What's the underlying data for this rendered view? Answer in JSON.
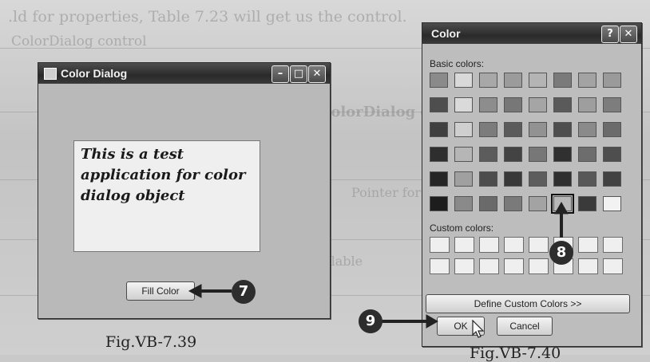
{
  "background_text": [
    ".ld for properties, Table 7.23 will get us the control.",
    "ColorDialog control",
    "ColorDialog co",
    "Fill Color",
    "Pointer for the",
    "Available",
    "Custom"
  ],
  "window_left": {
    "title": "Color Dialog",
    "minimize_glyph": "–",
    "maximize_glyph": "□",
    "close_glyph": "✕",
    "text_content": "This is a test application for color dialog object",
    "fill_button_label": "Fill Color"
  },
  "window_right": {
    "title": "Color",
    "help_glyph": "?",
    "close_glyph": "✕",
    "basic_colors_label": "Basic colors:",
    "custom_colors_label": "Custom colors:",
    "define_button_label": "Define Custom Colors >>",
    "ok_label": "OK",
    "cancel_label": "Cancel",
    "basic_colors": [
      [
        "#8a8a8a",
        "#d9d9d9",
        "#a8a8a8",
        "#9b9b9b",
        "#b4b4b4",
        "#7a7a7a",
        "#a3a3a3",
        "#9a9a9a"
      ],
      [
        "#4e4e4e",
        "#dadada",
        "#8d8d8d",
        "#777777",
        "#a5a5a5",
        "#5a5a5a",
        "#9e9e9e",
        "#7d7d7d"
      ],
      [
        "#3f3f3f",
        "#cfcfcf",
        "#7c7c7c",
        "#5b5b5b",
        "#929292",
        "#4e4e4e",
        "#8a8a8a",
        "#6b6b6b"
      ],
      [
        "#2e2e2e",
        "#b6b6b6",
        "#5c5c5c",
        "#434343",
        "#777777",
        "#303030",
        "#6d6d6d",
        "#4e4e4e"
      ],
      [
        "#252525",
        "#a0a0a0",
        "#4d4d4d",
        "#393939",
        "#5d5d5d",
        "#2f2f2f",
        "#585858",
        "#424242"
      ],
      [
        "#1d1d1d",
        "#8a8a8a",
        "#6a6a6a",
        "#7a7a7a",
        "#a3a3a3",
        "#b8b8b8",
        "#3a3a3a",
        "#f2f2f2"
      ]
    ],
    "selected_basic": [
      5,
      5
    ],
    "custom_rows": 2,
    "custom_cols": 8
  },
  "callouts": [
    "7",
    "8",
    "9"
  ],
  "captions": {
    "left": "Fig.VB-7.39",
    "right": "Fig.VB-7.40"
  }
}
